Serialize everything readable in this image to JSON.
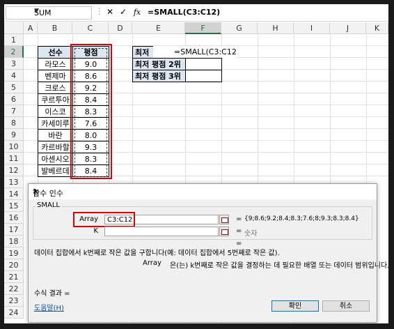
{
  "formula_bar": {
    "name_box": "SUM",
    "cancel_glyph": "✕",
    "enter_glyph": "✓",
    "fx_label": "fx",
    "formula": "=SMALL(C3:C12)"
  },
  "columns": [
    "A",
    "B",
    "C",
    "D",
    "E",
    "F",
    "G",
    "H",
    "I",
    "J",
    "K"
  ],
  "rows": [
    "1",
    "2",
    "3",
    "4",
    "5",
    "6",
    "7",
    "8",
    "9",
    "10",
    "11",
    "12",
    "13",
    "14",
    "15",
    "16",
    "17",
    "18",
    "19",
    "20",
    "21",
    "22",
    "23",
    "24"
  ],
  "table": {
    "header_player": "선수",
    "header_score": "평점",
    "players": [
      "라모스",
      "벤제마",
      "크로스",
      "쿠르투아",
      "이스코",
      "카세미루",
      "바란",
      "카르바할",
      "아센시오",
      "발베르데"
    ],
    "scores": [
      "9.0",
      "8.6",
      "9.2",
      "8.4",
      "8.3",
      "7.6",
      "8.0",
      "9.3",
      "8.3",
      "8.4"
    ]
  },
  "side_table": {
    "labels": [
      "최저",
      "최저 평점 2위",
      "최저 평점 3위"
    ],
    "editing_formula": "=SMALL(C3:C12)"
  },
  "dialog": {
    "title": "함수 인수",
    "help_glyph": "?",
    "close_glyph": "✕",
    "function_name": "SMALL",
    "arg1_label": "Array",
    "arg1_value": "C3:C12",
    "arg1_result": "{9;8.6;9.2;8.4;8.3;7.6;8;9.3;8.3;8.4}",
    "arg2_label": "K",
    "arg2_value": "",
    "arg2_result": "숫자",
    "equals": "=",
    "description": "데이터 집합에서 k번째로 작은 값을 구합니다(예: 데이터 집합에서 5번째로 작은 값).",
    "arg_desc_name": "Array",
    "arg_desc": "은(는) k번째로 작은 값을 결정하는 데 필요한 배열 또는 데이터 범위입니다.",
    "result_label": "수식 결과 =",
    "help_link": "도움말(H)",
    "ok": "확인",
    "cancel": "취소"
  }
}
